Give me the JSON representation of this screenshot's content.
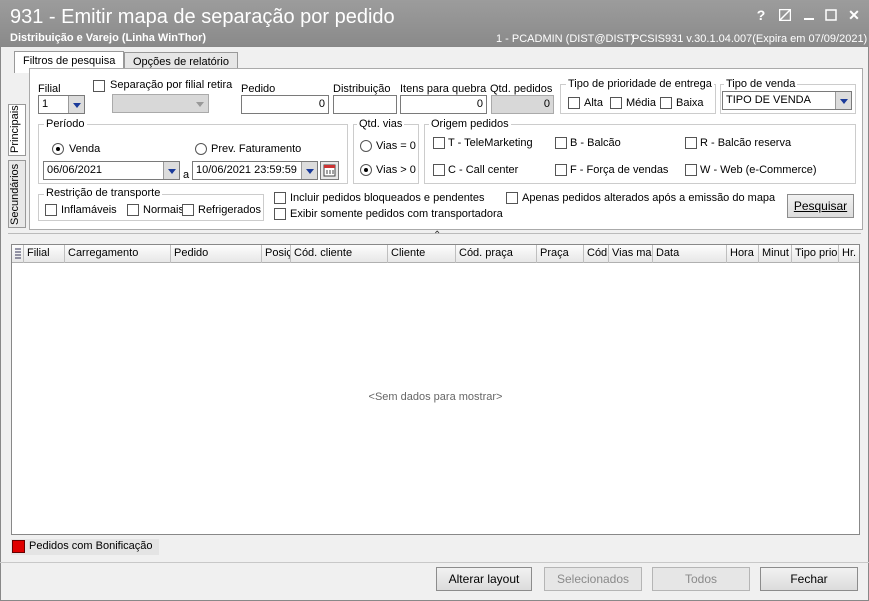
{
  "window": {
    "title": "931 - Emitir mapa de separação por pedido",
    "subtitle": "Distribuição e Varejo (Linha WinThor)",
    "user_info": "1 - PCADMIN (DIST@DIST)",
    "version_info": "PCSIS931  v.30.1.04.007(Expira em 07/09/2021)",
    "help_glyph": "?",
    "close_glyph": "✕"
  },
  "tabs": [
    "Filtros de pesquisa",
    "Opções de relatório"
  ],
  "side_tabs": [
    "Principais",
    "Secundários"
  ],
  "filters": {
    "filial_label": "Filial",
    "filial_value": "1",
    "separacao_label": "Separação por filial retira",
    "pedido_label": "Pedido",
    "pedido_value": "0",
    "distribuicao_label": "Distribuição",
    "itens_label": "Itens para quebra",
    "itens_value": "0",
    "qtd_pedidos_label": "Qtd. pedidos",
    "qtd_pedidos_value": "0",
    "prioridade_label": "Tipo de prioridade de  entrega",
    "prioridade_options": [
      "Alta",
      "Média",
      "Baixa"
    ],
    "tipo_venda_label": "Tipo de venda",
    "tipo_venda_value": "TIPO DE VENDA",
    "periodo_label": "Período",
    "periodo_venda": "Venda",
    "periodo_prev": "Prev. Faturamento",
    "data_inicio": "06/06/2021",
    "data_sep": "a",
    "data_fim": "10/06/2021 23:59:59",
    "qtd_vias_label": "Qtd. vias",
    "vias_zero": "Vias = 0",
    "vias_maior": "Vias > 0",
    "origem_label": "Origem pedidos",
    "origem_options": [
      "T - TeleMarketing",
      "B - Balcão",
      "R - Balcão reserva",
      "C - Call center",
      "F - Força de vendas",
      "W - Web (e-Commerce)"
    ],
    "restricao_label": "Restrição de transporte",
    "restricao_options": [
      "Inflamáveis",
      "Normais",
      "Refrigerados"
    ],
    "incluir_bloqueados": "Incluir pedidos bloqueados e pendentes",
    "exibir_transportadora": "Exibir somente pedidos com transportadora",
    "apenas_alterados": "Apenas pedidos alterados após a emissão do mapa",
    "pesquisar": "Pesquisar"
  },
  "grid": {
    "columns": [
      "Filial",
      "Carregamento",
      "Pedido",
      "Posiç",
      "Cód. cliente",
      "Cliente",
      "Cód. praça",
      "Praça",
      "Cód",
      "Vias mar",
      "Data",
      "Hora",
      "Minut",
      "Tipo prio",
      "Hr."
    ],
    "empty_message": "<Sem dados para mostrar>"
  },
  "legend": {
    "label": "Pedidos com Bonificação",
    "color": "#e00000"
  },
  "footer": {
    "alterar_layout": "Alterar layout",
    "selecionados": "Selecionados",
    "todos": "Todos",
    "fechar": "Fechar"
  }
}
